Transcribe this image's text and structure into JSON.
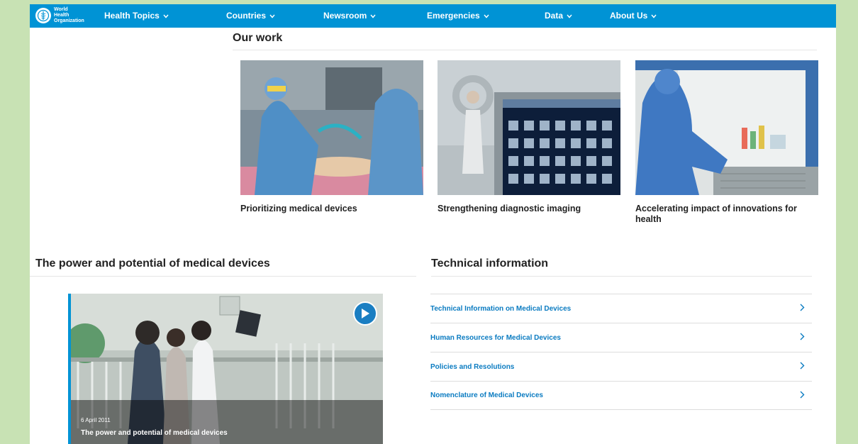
{
  "nav": {
    "logo_line1": "World Health",
    "logo_line2": "Organization",
    "items": [
      {
        "label": "Health Topics"
      },
      {
        "label": "Countries"
      },
      {
        "label": "Newsroom"
      },
      {
        "label": "Emergencies"
      },
      {
        "label": "Data"
      },
      {
        "label": "About Us"
      }
    ]
  },
  "our_work": {
    "title": "Our work",
    "cards": [
      {
        "caption": "Prioritizing medical devices"
      },
      {
        "caption": "Strengthening diagnostic imaging"
      },
      {
        "caption": "Accelerating impact of innovations for health"
      }
    ]
  },
  "power": {
    "title": "The power and potential of medical devices",
    "video": {
      "date": "6 April 2011",
      "title": "The power and potential of medical devices"
    }
  },
  "technical": {
    "title": "Technical information",
    "links": [
      {
        "label": "Technical Information on Medical Devices"
      },
      {
        "label": "Human Resources for Medical Devices"
      },
      {
        "label": "Policies and Resolutions"
      },
      {
        "label": "Nomenclature of Medical Devices"
      }
    ]
  },
  "colors": {
    "brand_blue": "#0093d5",
    "link_blue": "#0a7bc1",
    "side_green": "#c8e2b4"
  },
  "icons": {
    "logo": "who-emblem-icon",
    "nav_chevron": "chevron-down-icon",
    "list_chevron": "chevron-right-icon",
    "play": "play-icon"
  }
}
